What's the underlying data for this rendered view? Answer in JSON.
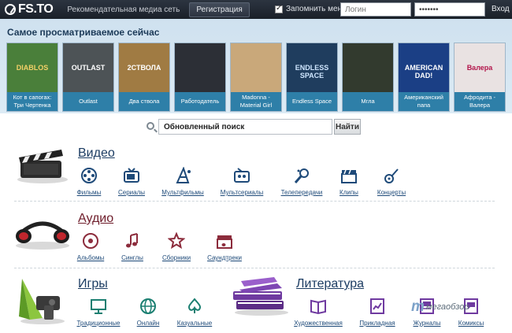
{
  "header": {
    "logo_text": "FS.TO",
    "recommend_label": "Рекомендательная медиа сеть",
    "register_label": "Регистрация",
    "remember_label": "Запомнить меня",
    "login_placeholder": "Логин",
    "password_value": "•••••••",
    "enter_label": "Вход"
  },
  "most_viewed": {
    "title": "Самое просматриваемое сейчас",
    "items": [
      {
        "caption": "Кот в сапогах: Три Чертенка",
        "art_text": "DIABLOS",
        "bg": "#4a7f3a",
        "fg": "#f2d067"
      },
      {
        "caption": "Outlast",
        "art_text": "OUTLAST",
        "bg": "#4d5356",
        "fg": "#ffffff"
      },
      {
        "caption": "Два ствола",
        "art_text": "2СТВОЛА",
        "bg": "#a07b43",
        "fg": "#ffffff"
      },
      {
        "caption": "Работодатель",
        "art_text": "",
        "bg": "#2c2f36",
        "fg": "#ffffff"
      },
      {
        "caption": "Madonna - Material Girl",
        "art_text": "",
        "bg": "#c9a87a",
        "fg": "#ffffff"
      },
      {
        "caption": "Endless Space",
        "art_text": "ENDLESS SPACE",
        "bg": "#1f3d5e",
        "fg": "#cfe6ff"
      },
      {
        "caption": "Мгла",
        "art_text": "",
        "bg": "#323a2e",
        "fg": "#ffffff"
      },
      {
        "caption": "Американский папа",
        "art_text": "AMERICAN DAD!",
        "bg": "#1b3f85",
        "fg": "#ffffff"
      },
      {
        "caption": "Афродита - Валера",
        "art_text": "Валера",
        "bg": "#e9e2e2",
        "fg": "#b3164b"
      }
    ]
  },
  "search": {
    "value": "Обновленный поиск",
    "button_label": "Найти"
  },
  "video": {
    "title": "Видео",
    "items": [
      {
        "label": "Фильмы",
        "icon": "film-reel-icon"
      },
      {
        "label": "Сериалы",
        "icon": "tv-icon"
      },
      {
        "label": "Мультфильмы",
        "icon": "party-hat-icon"
      },
      {
        "label": "Мультсериалы",
        "icon": "cartoon-tv-icon"
      },
      {
        "label": "Телепередачи",
        "icon": "microphone-icon"
      },
      {
        "label": "Клипы",
        "icon": "clapper-icon"
      },
      {
        "label": "Концерты",
        "icon": "guitar-icon"
      }
    ]
  },
  "audio": {
    "title": "Аудио",
    "items": [
      {
        "label": "Альбомы",
        "icon": "disc-icon"
      },
      {
        "label": "Синглы",
        "icon": "music-note-icon"
      },
      {
        "label": "Сборники",
        "icon": "stars-icon"
      },
      {
        "label": "Саундтреки",
        "icon": "clapper-note-icon"
      }
    ]
  },
  "games": {
    "title": "Игры",
    "items": [
      {
        "label": "Традиционные",
        "icon": "monitor-icon"
      },
      {
        "label": "Онлайн",
        "icon": "globe-icon"
      },
      {
        "label": "Казуальные",
        "icon": "spade-icon"
      }
    ]
  },
  "literature": {
    "title": "Литература",
    "items": [
      {
        "label": "Художественная",
        "icon": "open-book-icon"
      },
      {
        "label": "Прикладная",
        "icon": "chart-book-icon"
      },
      {
        "label": "Журналы",
        "icon": "magazine-icon"
      },
      {
        "label": "Комиксы",
        "icon": "comics-icon"
      }
    ]
  },
  "watermark": {
    "mark": "m",
    "text": "мегаобзор"
  },
  "colors": {
    "link": "#1e4a79",
    "audio_title": "#6e1c2a",
    "caption_bg": "#2e7fa8"
  }
}
